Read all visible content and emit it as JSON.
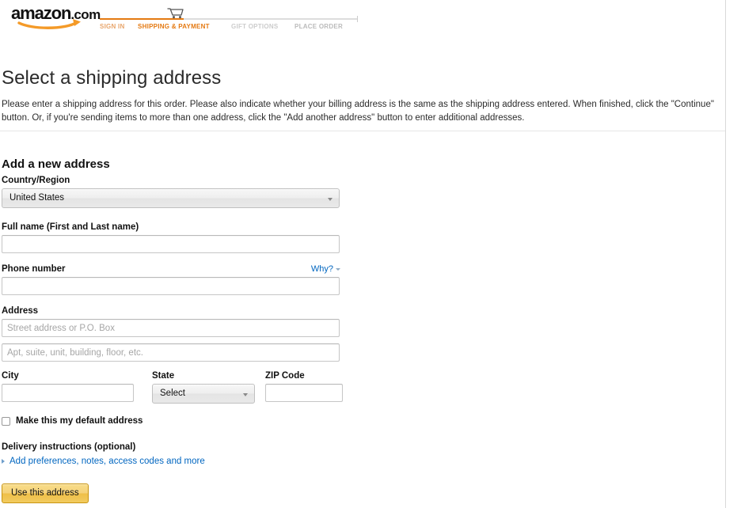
{
  "header": {
    "logo_text": "amazon",
    "logo_suffix": ".com",
    "logo_icon": "amazon-smile-swoosh",
    "cart_icon": "shopping-cart-icon",
    "steps": [
      {
        "label": "SIGN IN",
        "state": "completed"
      },
      {
        "label": "SHIPPING & PAYMENT",
        "state": "active"
      },
      {
        "label": "GIFT OPTIONS",
        "state": "upcoming"
      },
      {
        "label": "PLACE ORDER",
        "state": "upcoming"
      }
    ]
  },
  "page": {
    "title": "Select a shipping address",
    "intro": "Please enter a shipping address for this order. Please also indicate whether your billing address is the same as the shipping address entered. When finished, click the \"Continue\" button.  Or, if you're sending items to more than one address, click the \"Add another address\" button to enter additional addresses.",
    "section_title": "Add a new address"
  },
  "form": {
    "country": {
      "label": "Country/Region",
      "value": "United States"
    },
    "full_name": {
      "label": "Full name (First and Last name)",
      "value": "",
      "placeholder": ""
    },
    "phone": {
      "label": "Phone number",
      "value": "",
      "placeholder": "",
      "why_label": "Why?"
    },
    "address": {
      "label": "Address",
      "line1_value": "",
      "line1_placeholder": "Street address or P.O. Box",
      "line2_value": "",
      "line2_placeholder": "Apt, suite, unit, building, floor, etc."
    },
    "city": {
      "label": "City",
      "value": "",
      "placeholder": ""
    },
    "state": {
      "label": "State",
      "value": "Select"
    },
    "zip": {
      "label": "ZIP Code",
      "value": "",
      "placeholder": ""
    },
    "default_address": {
      "label": "Make this my default address",
      "checked": false
    },
    "delivery_instructions": {
      "label": "Delivery instructions (optional)",
      "expander_label": "Add preferences, notes, access codes and more"
    },
    "submit_label": "Use this address"
  },
  "colors": {
    "amazon_orange": "#e47911",
    "link_blue": "#0066c0",
    "button_gold": "#f2cb5f",
    "step_upcoming_gray": "#cccccc"
  }
}
